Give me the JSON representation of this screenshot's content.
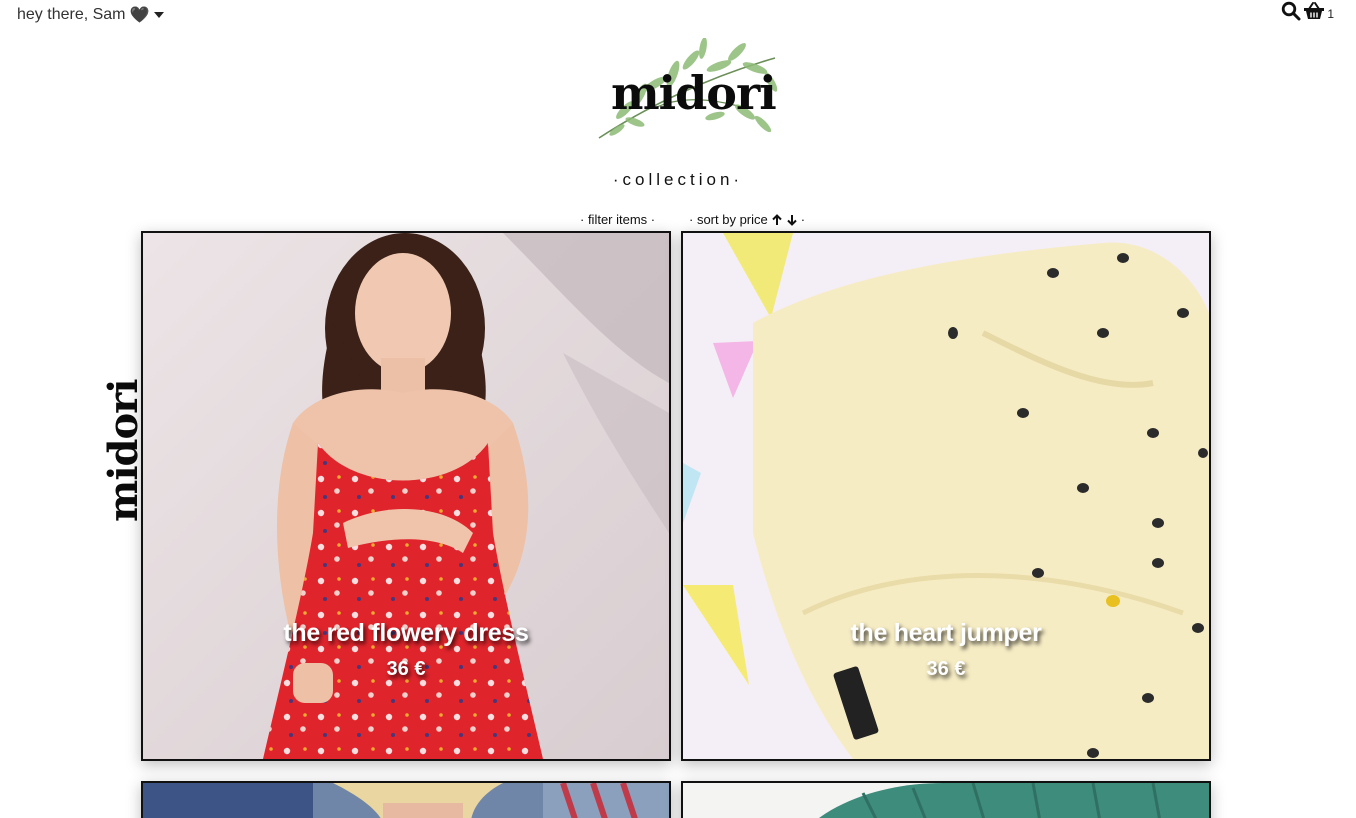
{
  "header": {
    "greeting": "hey there, Sam",
    "heart": "🖤",
    "cart_count": "1",
    "icons": [
      "search-icon",
      "basket-icon"
    ]
  },
  "brand": {
    "logo_text": "midori",
    "side_text": "midori"
  },
  "collection": {
    "heading": "·collection·",
    "filter_label": "· filter items ·",
    "sort_label": "· sort by price",
    "sort_suffix": "·"
  },
  "products": [
    {
      "name": "the red flowery dress",
      "price": "36 €"
    },
    {
      "name": "the heart jumper",
      "price": "36 €"
    }
  ],
  "colors": {
    "text": "#111111",
    "card_border": "#111111",
    "dress_red": "#e0242c",
    "jumper_cream": "#f6ecc4",
    "leaf_green": "#7fae6a"
  }
}
